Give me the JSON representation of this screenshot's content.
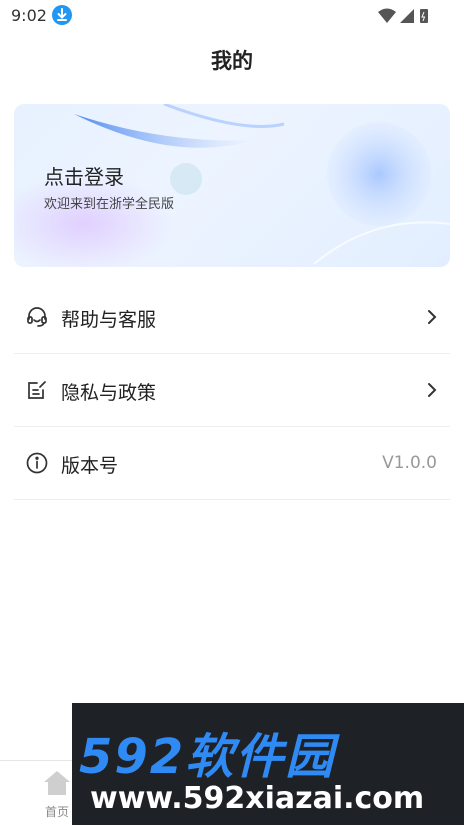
{
  "status_bar": {
    "time": "9:02"
  },
  "header": {
    "title": "我的"
  },
  "login_card": {
    "title": "点击登录",
    "subtitle": "欢迎来到在浙学全民版"
  },
  "menu": {
    "items": [
      {
        "label": "帮助与客服",
        "icon": "headset-icon"
      },
      {
        "label": "隐私与政策",
        "icon": "edit-document-icon"
      },
      {
        "label": "版本号",
        "icon": "info-icon",
        "value": "V1.0.0"
      }
    ]
  },
  "tabbar": {
    "home_label": "首页"
  },
  "watermark": {
    "brand": "592软件园",
    "url": "www.592xiazai.com"
  },
  "colors": {
    "accent": "#2196f3",
    "card_bg": "#e7f1ff",
    "watermark_blue": "#2f8af3"
  }
}
